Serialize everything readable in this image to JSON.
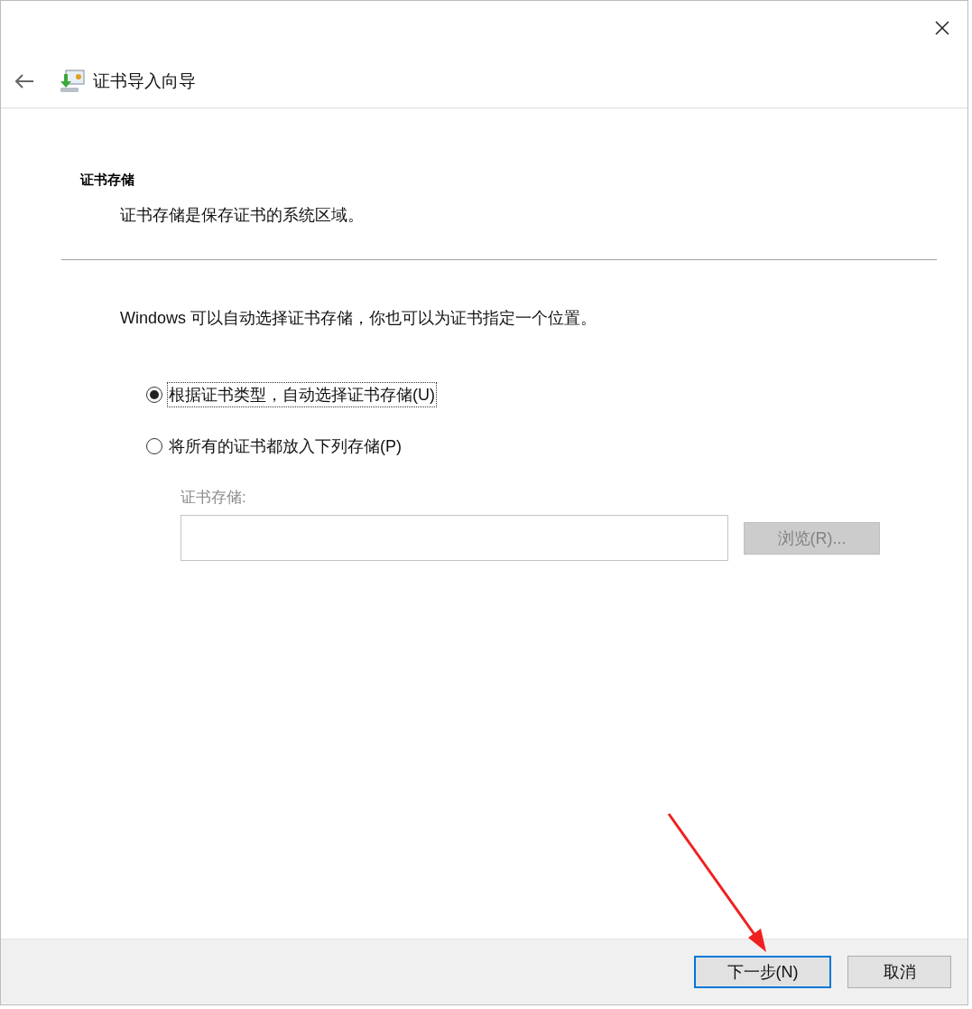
{
  "window": {
    "title": "证书导入向导"
  },
  "page": {
    "heading": "证书存储",
    "description": "证书存储是保存证书的系统区域。"
  },
  "intro": "Windows 可以自动选择证书存储，你也可以为证书指定一个位置。",
  "options": [
    {
      "label": "根据证书类型，自动选择证书存储(U)",
      "selected": true,
      "focused": true
    },
    {
      "label": "将所有的证书都放入下列存储(P)",
      "selected": false,
      "focused": false
    }
  ],
  "store_field": {
    "label": "证书存储:",
    "disabled": true
  },
  "browse_button": {
    "label": "浏览(R)...",
    "disabled": true
  },
  "buttons": [
    {
      "label": "下一步(N)",
      "default": true
    },
    {
      "label": "取消",
      "default": false
    }
  ]
}
